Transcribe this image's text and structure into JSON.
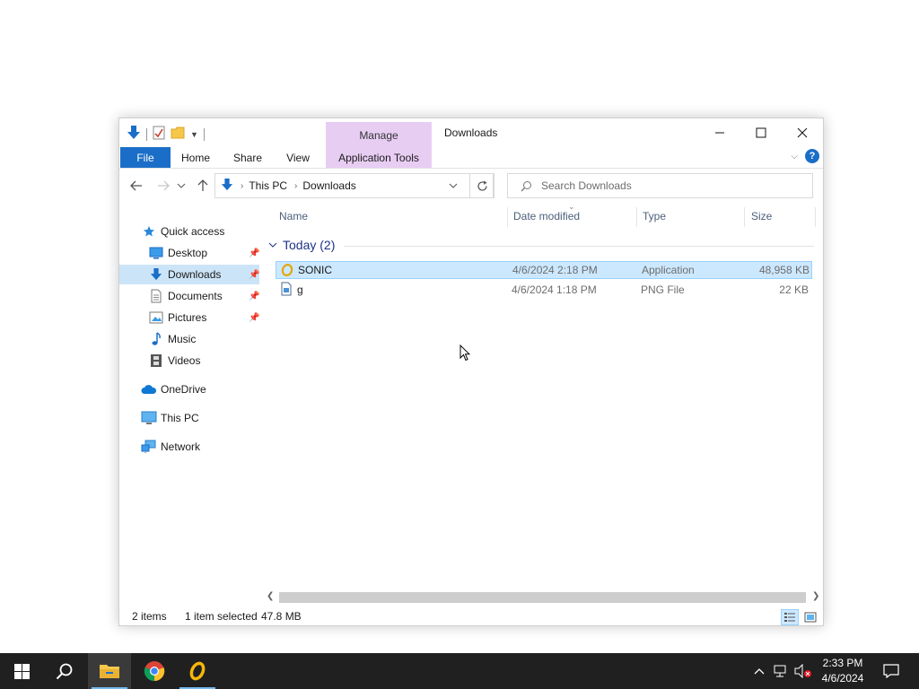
{
  "window": {
    "title": "Downloads",
    "contextual_tab_group": "Manage",
    "contextual_tab": "Application Tools"
  },
  "ribbon": {
    "file": "File",
    "tabs": [
      "Home",
      "Share",
      "View"
    ]
  },
  "address": {
    "crumbs": [
      "This PC",
      "Downloads"
    ]
  },
  "search": {
    "placeholder": "Search Downloads"
  },
  "sidebar": {
    "quick_access": "Quick access",
    "items": [
      {
        "label": "Desktop",
        "icon": "desktop-icon",
        "pinned": true
      },
      {
        "label": "Downloads",
        "icon": "downloads-icon",
        "pinned": true,
        "selected": true
      },
      {
        "label": "Documents",
        "icon": "documents-icon",
        "pinned": true
      },
      {
        "label": "Pictures",
        "icon": "pictures-icon",
        "pinned": true
      },
      {
        "label": "Music",
        "icon": "music-icon",
        "pinned": false
      },
      {
        "label": "Videos",
        "icon": "videos-icon",
        "pinned": false
      }
    ],
    "onedrive": "OneDrive",
    "this_pc": "This PC",
    "network": "Network"
  },
  "columns": {
    "name": "Name",
    "date": "Date modified",
    "type": "Type",
    "size": "Size"
  },
  "group": {
    "label": "Today (2)"
  },
  "files": [
    {
      "name": "SONIC",
      "date": "4/6/2024 2:18 PM",
      "type": "Application",
      "size": "48,958 KB",
      "selected": true,
      "icon": "sonic-app-icon"
    },
    {
      "name": "g",
      "date": "4/6/2024 1:18 PM",
      "type": "PNG File",
      "size": "22 KB",
      "selected": false,
      "icon": "png-file-icon"
    }
  ],
  "status": {
    "items": "2 items",
    "selected": "1 item selected",
    "size": "47.8 MB"
  },
  "taskbar": {
    "time": "2:33 PM",
    "date": "4/6/2024"
  },
  "colors": {
    "accent": "#1a6ec7",
    "manage_tab": "#e8cdf3",
    "selection": "#cce8ff",
    "taskbar": "#202020"
  }
}
